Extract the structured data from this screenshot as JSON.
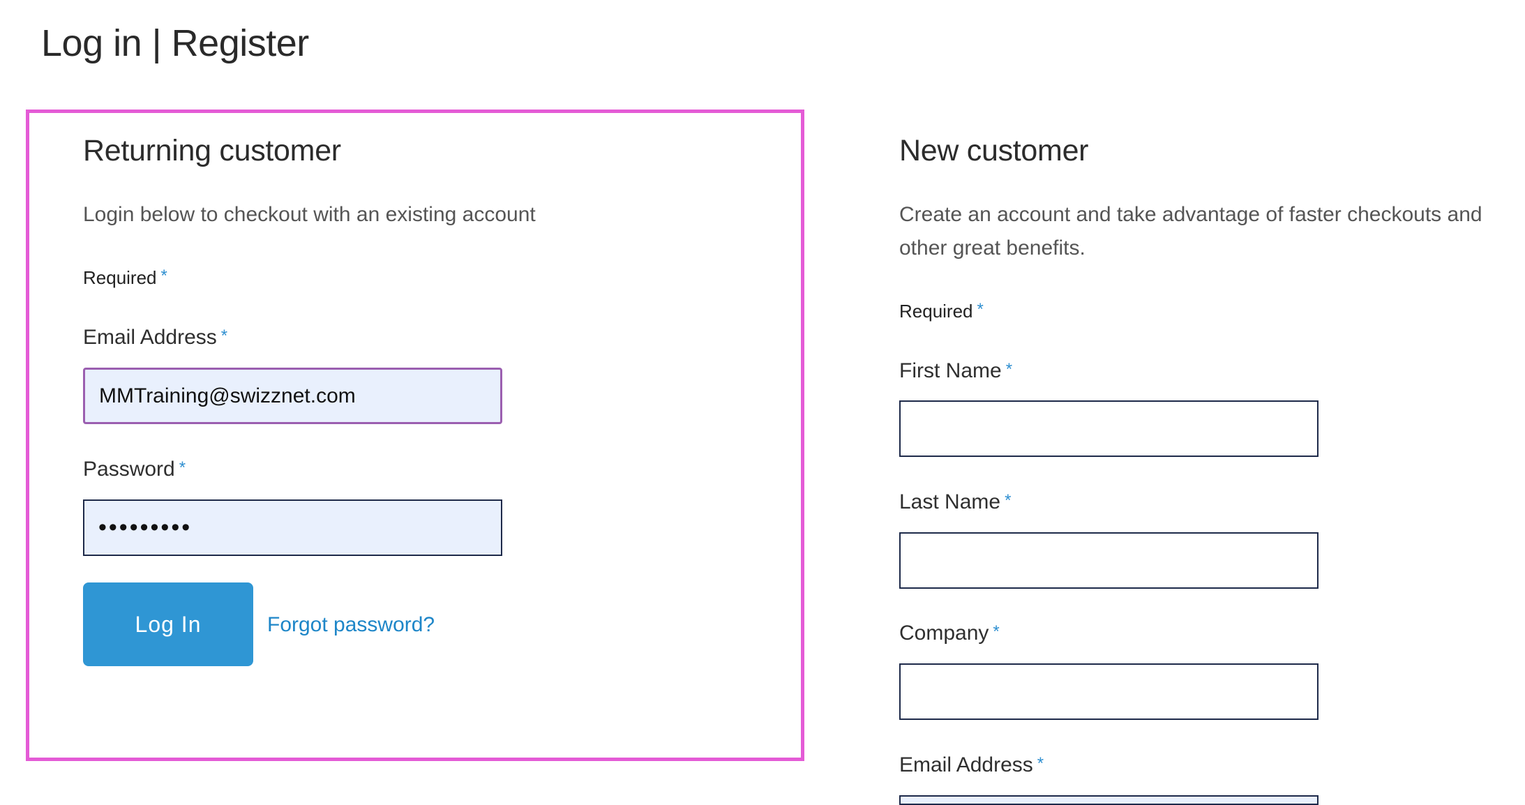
{
  "page": {
    "title": "Log in | Register"
  },
  "returning": {
    "title": "Returning customer",
    "description": "Login below to checkout with an existing account",
    "required_label": "Required",
    "email_label": "Email Address",
    "email_value": "MMTraining@swizznet.com",
    "password_label": "Password",
    "password_mask": "•••••••••",
    "login_button": "Log In",
    "forgot_link": "Forgot password?"
  },
  "new_customer": {
    "title": "New customer",
    "description": "Create an account and take advantage of faster checkouts and other great benefits.",
    "required_label": "Required",
    "first_name_label": "First Name",
    "last_name_label": "Last Name",
    "company_label": "Company",
    "email_label": "Email Address"
  },
  "colors": {
    "highlight": "#e45bd6",
    "accent": "#2f96d4",
    "link": "#1e86c8",
    "required_asterisk": "#2f8fd0",
    "input_fill": "#e9f0fd"
  }
}
